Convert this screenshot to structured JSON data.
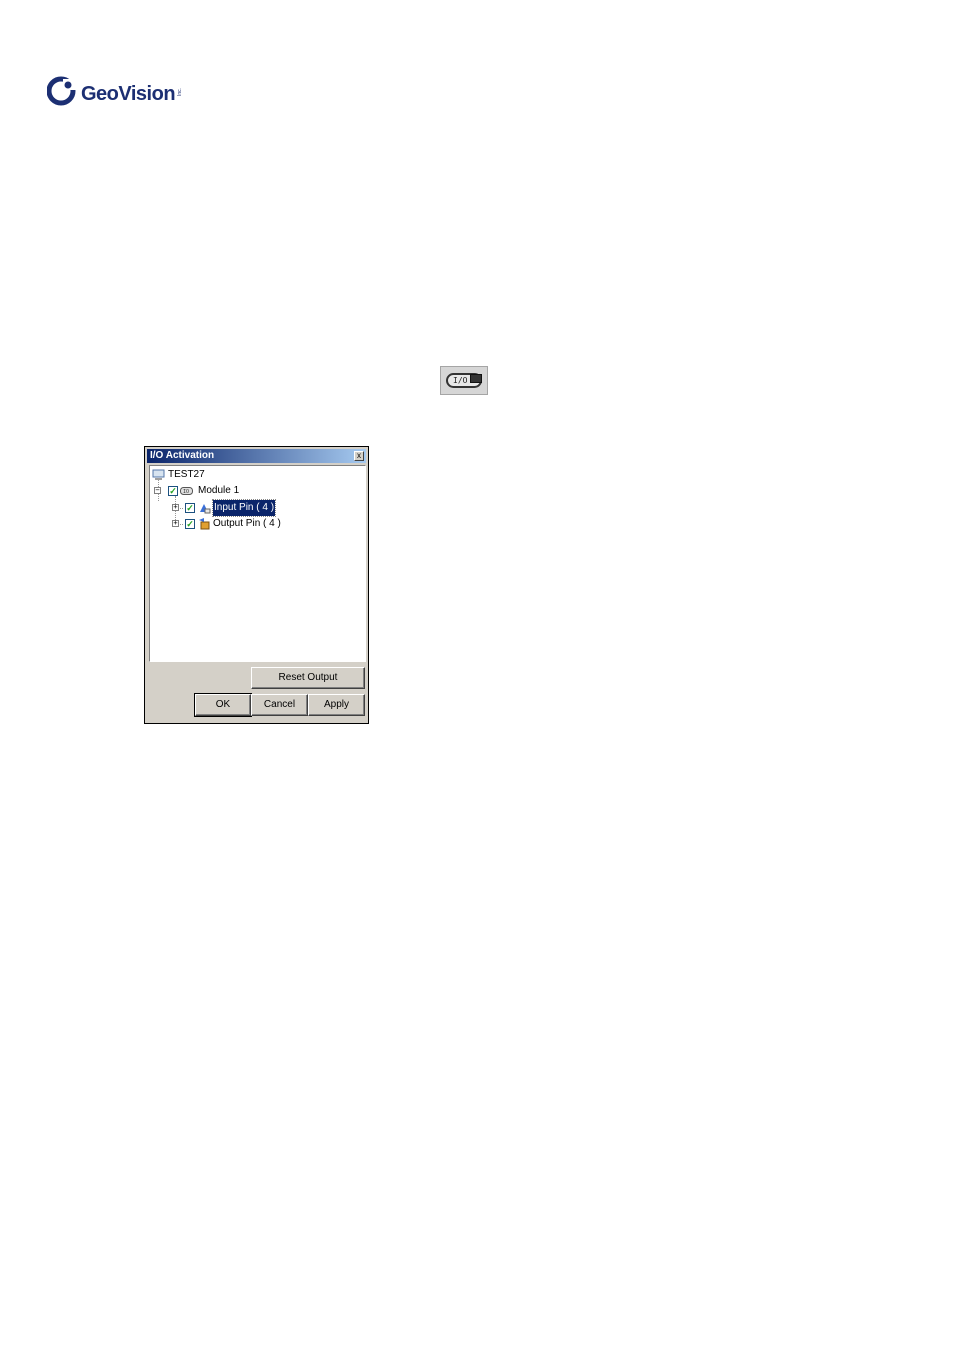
{
  "logo": {
    "text": "GeoVision",
    "mark": "Inc."
  },
  "toolbar_button": {
    "label": "I/O",
    "icon": "io-icon"
  },
  "dialog": {
    "title": "I/O Activation",
    "close_label": "x",
    "tree": {
      "root": {
        "label": "TEST27",
        "icon": "computer-icon"
      },
      "module": {
        "label": "Module 1",
        "icon": "io-module-icon",
        "checked": true,
        "expanded": true
      },
      "input_pin": {
        "label": "Input Pin ( 4 )",
        "icon": "input-pin-icon",
        "checked": true,
        "selected": true
      },
      "output_pin": {
        "label": "Output Pin ( 4 )",
        "icon": "output-pin-icon",
        "checked": true
      }
    },
    "buttons": {
      "reset_output": "Reset Output",
      "ok": "OK",
      "cancel": "Cancel",
      "apply": "Apply"
    }
  },
  "colors": {
    "brand": "#1c2f73",
    "titlebar_start": "#0a246a",
    "titlebar_end": "#a6caf0",
    "dialog_face": "#d4d0c8",
    "checkmark": "#21a121"
  }
}
